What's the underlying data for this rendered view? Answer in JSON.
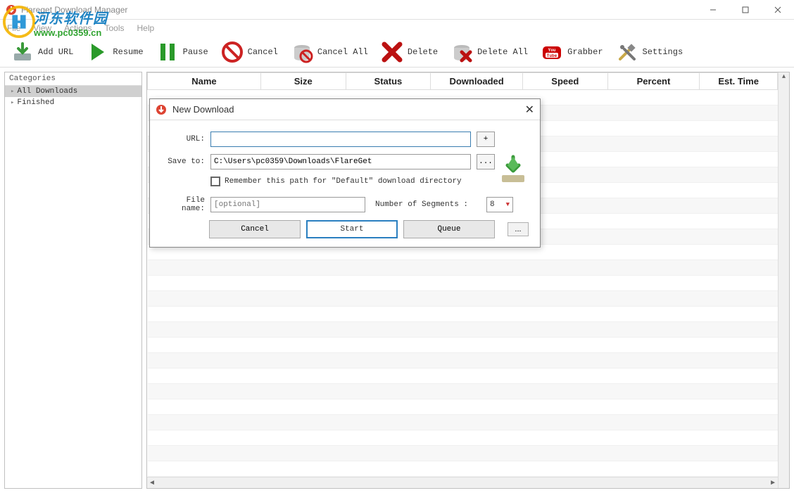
{
  "window": {
    "title": "Flareget Download Manager"
  },
  "menu": {
    "file": "File",
    "view": "View",
    "actions": "Actions",
    "tools": "Tools",
    "help": "Help"
  },
  "toolbar": {
    "add_url": "Add URL",
    "resume": "Resume",
    "pause": "Pause",
    "cancel": "Cancel",
    "cancel_all": "Cancel All",
    "delete": "Delete",
    "delete_all": "Delete All",
    "grabber": "Grabber",
    "settings": "Settings"
  },
  "sidebar": {
    "header": "Categories",
    "items": [
      {
        "label": "All Downloads",
        "selected": true
      },
      {
        "label": "Finished",
        "selected": false
      }
    ]
  },
  "table": {
    "columns": [
      "Name",
      "Size",
      "Status",
      "Downloaded",
      "Speed",
      "Percent",
      "Est. Time"
    ]
  },
  "dialog": {
    "title": "New Download",
    "url_label": "URL:",
    "url_value": "",
    "plus": "+",
    "save_to_label": "Save to:",
    "save_to_value": "C:\\Users\\pc0359\\Downloads\\FlareGet",
    "browse": "...",
    "remember": "Remember this path for \"Default\" download directory",
    "file_name_label": "File name:",
    "file_name_placeholder": "[optional]",
    "segments_label": "Number of Segments :",
    "segments_value": "8",
    "cancel": "Cancel",
    "start": "Start",
    "queue": "Queue",
    "dots": "..."
  },
  "watermark": {
    "cn": "河东软件园",
    "url": "www.pc0359.cn"
  }
}
